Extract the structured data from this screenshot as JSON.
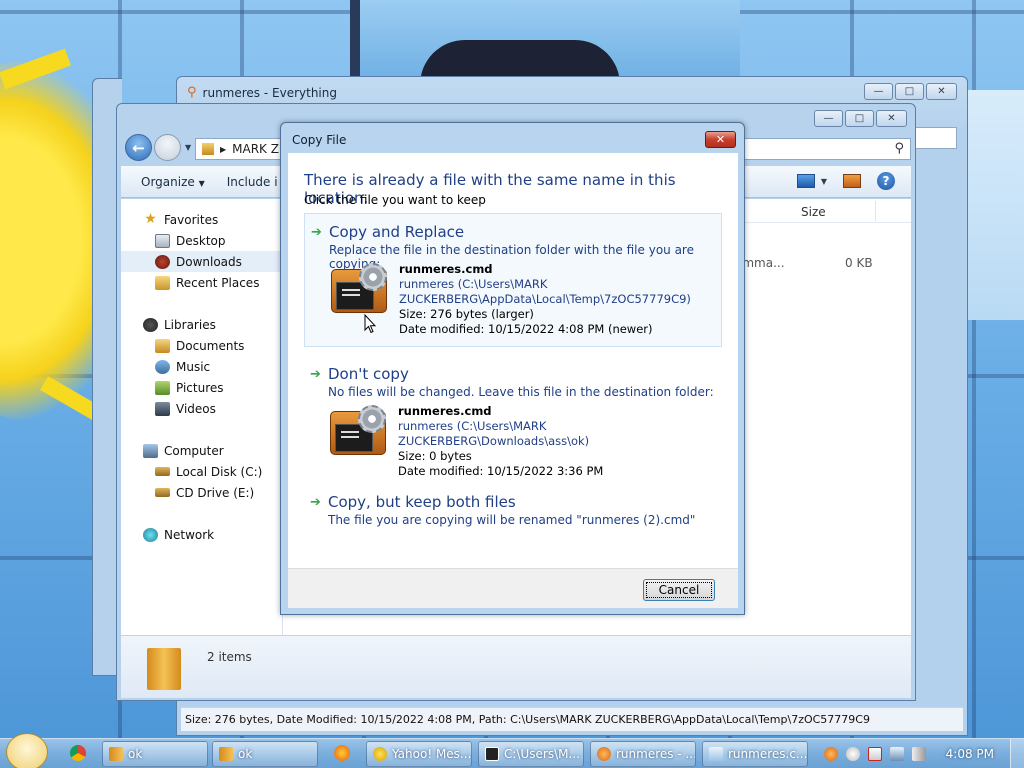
{
  "everything_window": {
    "title": "runmeres - Everything",
    "status_bar": "Size: 276 bytes, Date Modified: 10/15/2022 4:08 PM, Path: C:\\Users\\MARK ZUCKERBERG\\AppData\\Local\\Temp\\7zOC57779C9"
  },
  "explorer": {
    "address": "MARK Z",
    "toolbar": {
      "organize": "Organize",
      "include": "Include i"
    },
    "nav": {
      "favorites": "Favorites",
      "desktop": "Desktop",
      "downloads": "Downloads",
      "recent_places": "Recent Places",
      "libraries": "Libraries",
      "documents": "Documents",
      "music": "Music",
      "pictures": "Pictures",
      "videos": "Videos",
      "computer": "Computer",
      "local_disk": "Local Disk (C:)",
      "cd_drive": "CD Drive (E:)",
      "network": "Network"
    },
    "columns": {
      "size": "Size"
    },
    "row": {
      "type": "omma...",
      "size": "0 KB"
    },
    "details": {
      "item_count": "2 items"
    }
  },
  "dialog": {
    "title": "Copy File",
    "close_glyph": "✕",
    "headline": "There is already a file with the same name in this location.",
    "subtitle": "Click the file you want to keep",
    "option_replace": {
      "title": "Copy and Replace",
      "description": "Replace the file in the destination folder with the file you are copying:",
      "file_name": "runmeres.cmd",
      "path_line1": "runmeres (C:\\Users\\MARK",
      "path_line2": "ZUCKERBERG\\AppData\\Local\\Temp\\7zOC57779C9)",
      "size": "Size: 276 bytes (larger)",
      "modified": "Date modified: 10/15/2022 4:08 PM (newer)"
    },
    "option_dont_copy": {
      "title": "Don't copy",
      "description": "No files will be changed. Leave this file in the destination folder:",
      "file_name": "runmeres.cmd",
      "path": "runmeres (C:\\Users\\MARK ZUCKERBERG\\Downloads\\ass\\ok)",
      "size": "Size: 0 bytes",
      "modified": "Date modified: 10/15/2022 3:36 PM"
    },
    "option_keep_both": {
      "title": "Copy, but keep both files",
      "description": "The file you are copying will be renamed \"runmeres (2).cmd\""
    },
    "cancel_label": "Cancel"
  },
  "taskbar": {
    "items": [
      {
        "label": "ok"
      },
      {
        "label": "ok"
      },
      {
        "label": "Yahoo! Mes..."
      },
      {
        "label": "C:\\Users\\M..."
      },
      {
        "label": "runmeres - ..."
      },
      {
        "label": "runmeres.c..."
      }
    ],
    "clock": "4:08 PM"
  }
}
